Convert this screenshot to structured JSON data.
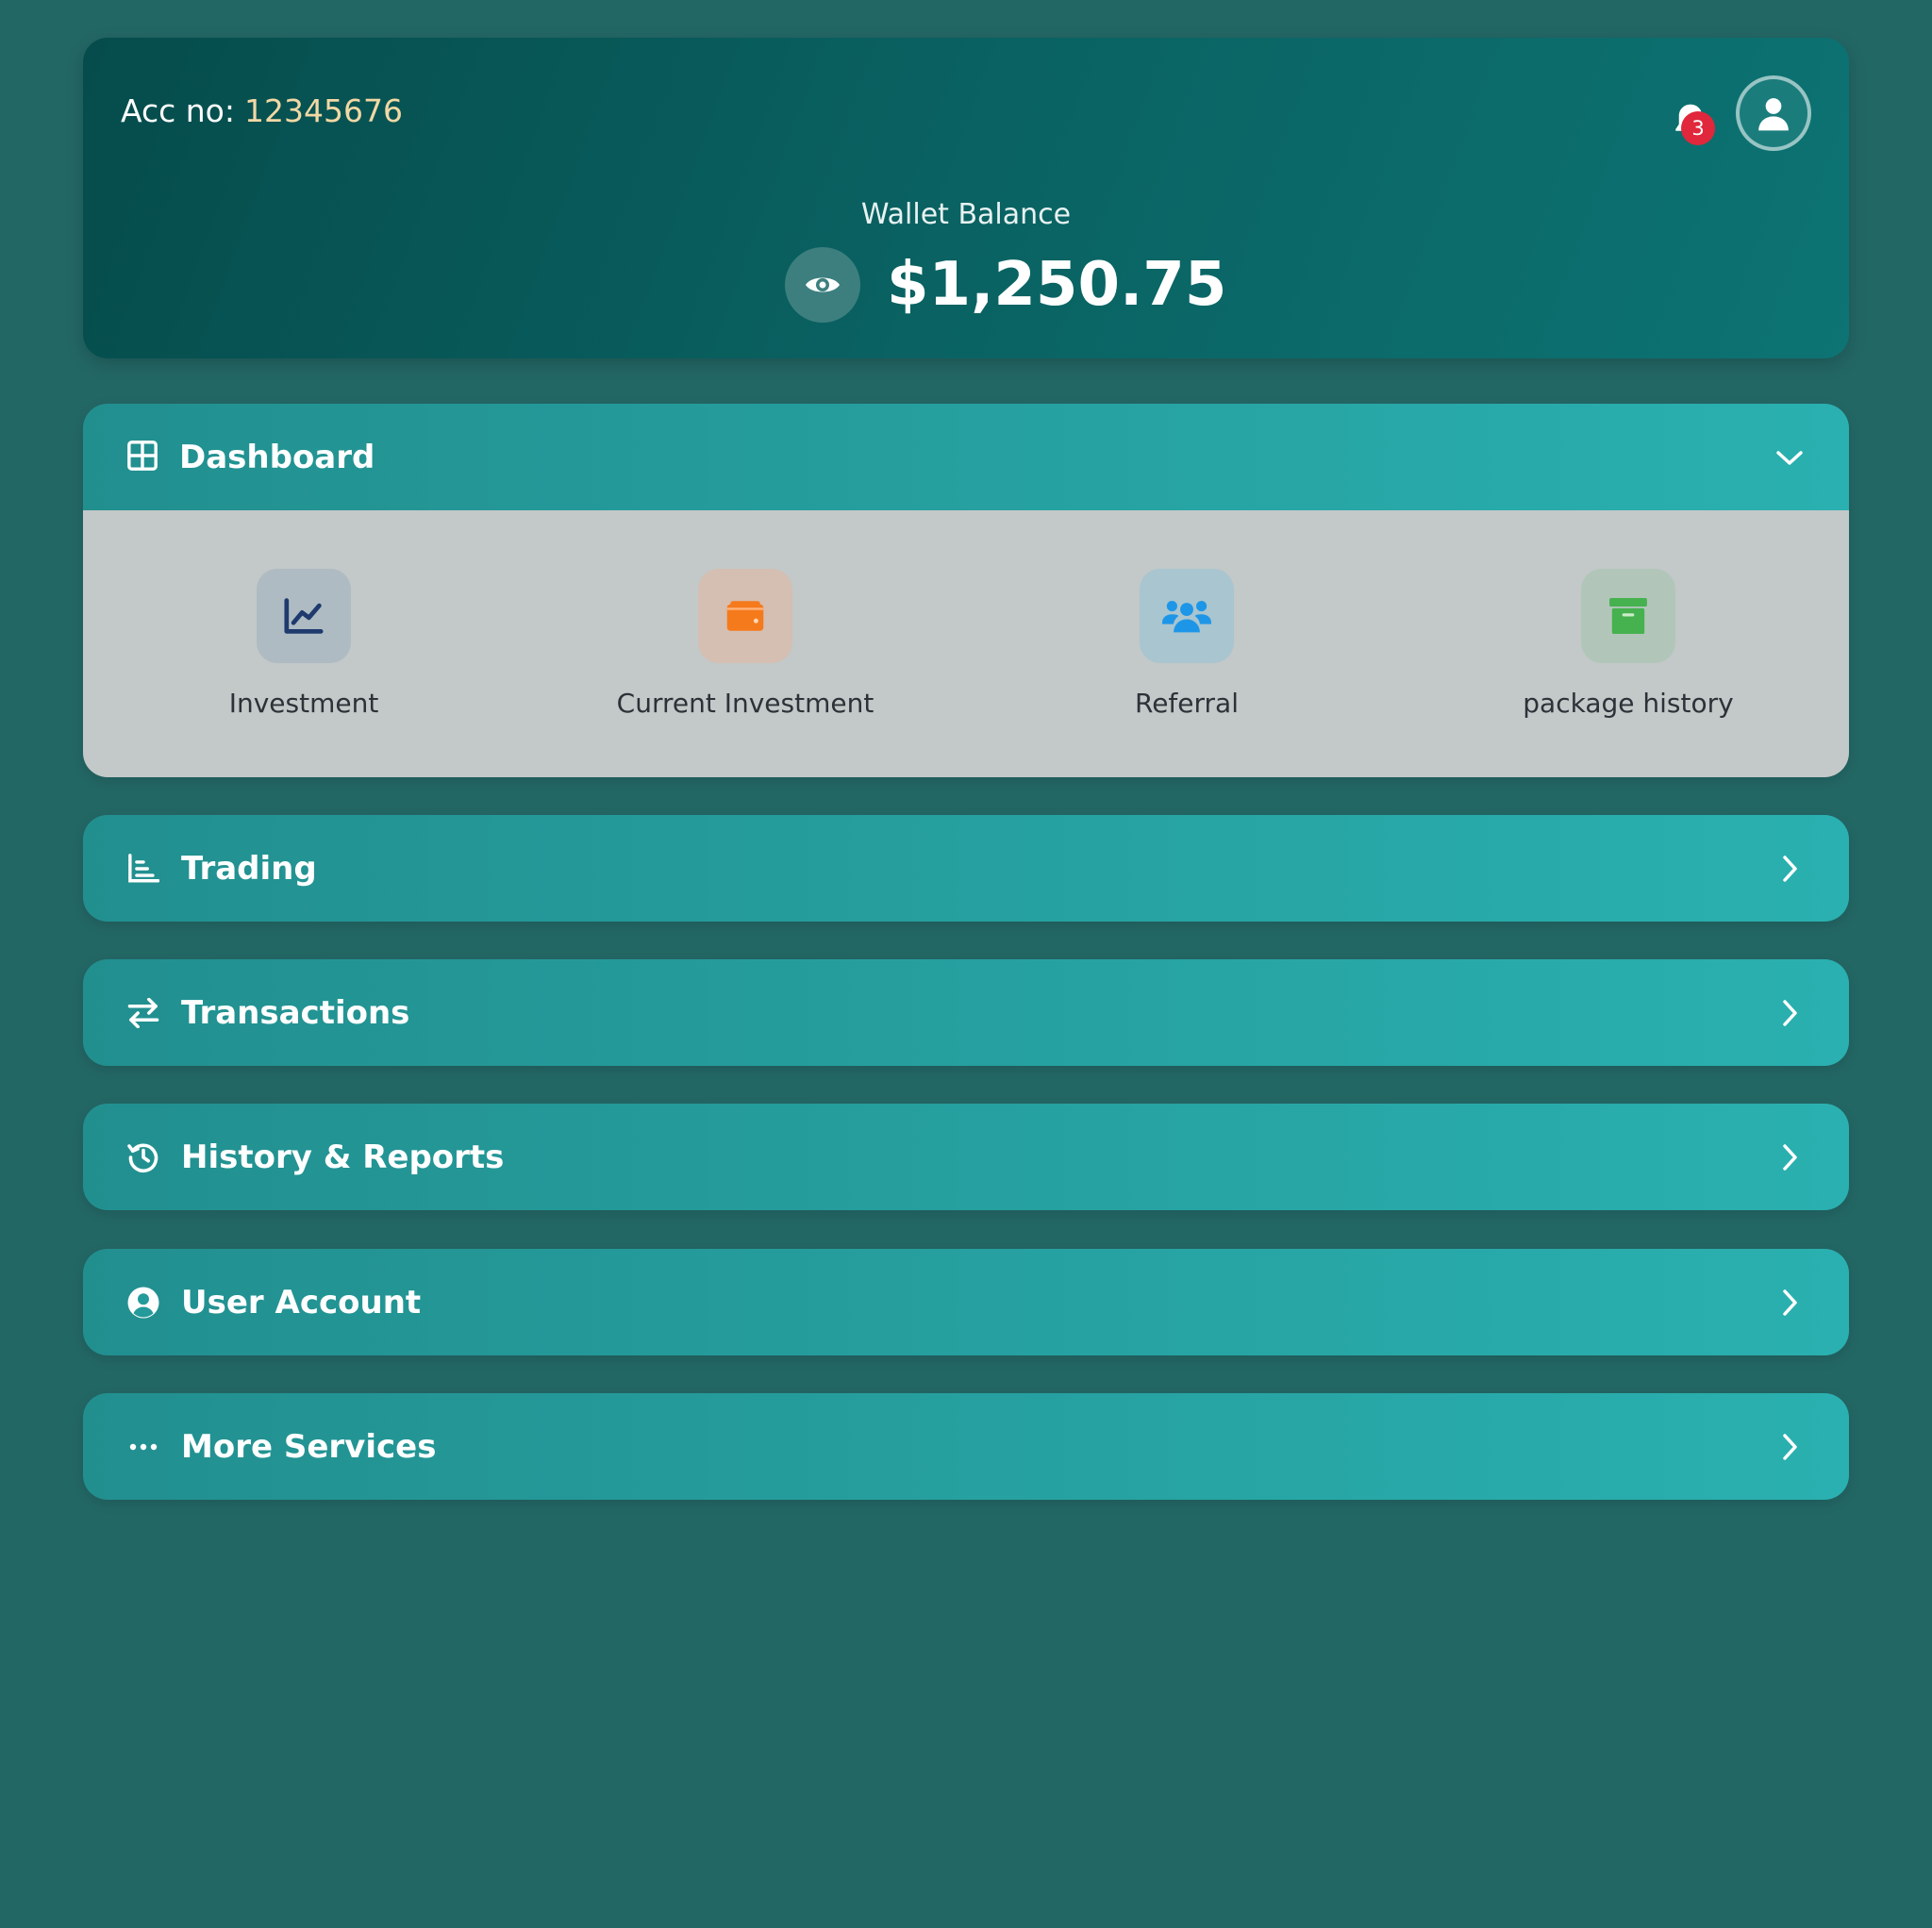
{
  "header": {
    "acc_label": "Acc no:",
    "acc_number": "12345676",
    "notification_count": "3",
    "wallet_label": "Wallet Balance",
    "balance": "$1,250.75"
  },
  "dashboard": {
    "title": "Dashboard",
    "tiles": [
      {
        "label": "Investment",
        "icon": "chart-line-icon",
        "bg": "#aebbc2",
        "color": "#1f3a6e"
      },
      {
        "label": "Current Investment",
        "icon": "wallet-icon",
        "bg": "#d4bfb2",
        "color": "#f57a1c"
      },
      {
        "label": "Referral",
        "icon": "users-icon",
        "bg": "#a9c5cf",
        "color": "#1e96e8"
      },
      {
        "label": "package history",
        "icon": "archive-icon",
        "bg": "#b1c6b9",
        "color": "#46b14f"
      }
    ]
  },
  "sections": [
    {
      "title": "Trading",
      "icon": "bar-chart-icon"
    },
    {
      "title": "Transactions",
      "icon": "exchange-icon"
    },
    {
      "title": "History & Reports",
      "icon": "history-icon"
    },
    {
      "title": "User Account",
      "icon": "user-circle-icon"
    },
    {
      "title": "More Services",
      "icon": "ellipsis-icon"
    }
  ],
  "colors": {
    "background": "#236765",
    "accent": "#2ab0b0",
    "badge": "#e0273b",
    "acc_number": "#f2d8a4"
  }
}
